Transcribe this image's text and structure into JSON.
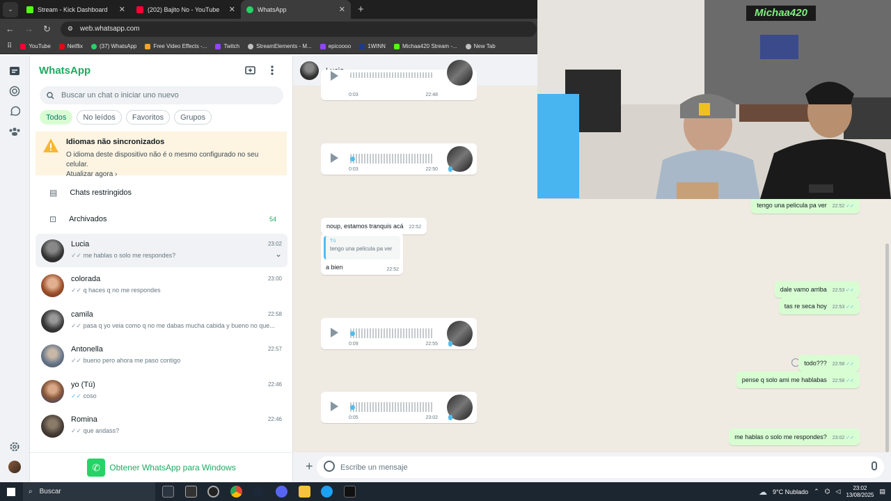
{
  "browser": {
    "tabs": [
      {
        "title": "Stream - Kick Dashboard",
        "color": "#53fc18"
      },
      {
        "title": "(202) Bajito No - YouTube",
        "color": "#ff0033"
      },
      {
        "title": "WhatsApp",
        "color": "#25d366"
      }
    ],
    "url": "web.whatsapp.com",
    "bookmarks": [
      {
        "label": "YouTube",
        "color": "#ff0033"
      },
      {
        "label": "Netflix",
        "color": "#e50914"
      },
      {
        "label": "(37) WhatsApp",
        "color": "#25d366"
      },
      {
        "label": "Free Video Effects -...",
        "color": "#f5a623"
      },
      {
        "label": "Twitch",
        "color": "#9146ff"
      },
      {
        "label": "StreamElements - M...",
        "color": "#c0c0c0"
      },
      {
        "label": "epicoooo",
        "color": "#9146ff"
      },
      {
        "label": "1WINN",
        "color": "#1e3a8a"
      },
      {
        "label": "Michaa420 Stream -...",
        "color": "#53fc18"
      },
      {
        "label": "New Tab",
        "color": "#c0c0c0"
      }
    ]
  },
  "sidebar": {
    "brand": "WhatsApp",
    "search_placeholder": "Buscar un chat o iniciar uno nuevo",
    "filters": [
      "Todos",
      "No leídos",
      "Favoritos",
      "Grupos"
    ],
    "warning": {
      "title": "Idiomas não sincronizados",
      "body": "O idioma deste dispositivo não é o mesmo configurado no seu celular.",
      "link": "Atualizar agora"
    },
    "restricted": "Chats restringidos",
    "archived": "Archivados",
    "archived_count": "54",
    "chats": [
      {
        "name": "Lucia",
        "time": "23:02",
        "msg": "me hablas o solo me respondes?",
        "tick": "grey",
        "avatar": "#555"
      },
      {
        "name": "colorada",
        "time": "23:00",
        "msg": "q haces q no me respondes",
        "tick": "grey",
        "avatar": "#a0522d"
      },
      {
        "name": "camila",
        "time": "22:58",
        "msg": "pasa q yo veia como q no me dabas mucha cabida y bueno no que...",
        "tick": "grey",
        "avatar": "#3a3a3a"
      },
      {
        "name": "Antonella",
        "time": "22:57",
        "msg": "bueno pero ahora me paso contigo",
        "tick": "grey",
        "avatar": "#6b7a8c"
      },
      {
        "name": "yo (Tú)",
        "time": "22:46",
        "msg": "coso",
        "tick": "blue",
        "avatar": "#8b5a3c"
      },
      {
        "name": "Romina",
        "time": "22:46",
        "msg": "que andass?",
        "tick": "grey",
        "avatar": "#4a4038"
      }
    ],
    "get_app": "Obtener WhatsApp para Windows"
  },
  "conversation": {
    "contact": "Lucia",
    "voice_notes": [
      {
        "duration": "0:03",
        "time": "22:48"
      },
      {
        "duration": "0:03",
        "time": "22:50"
      },
      {
        "duration": "0:09",
        "time": "22:55"
      },
      {
        "duration": "0:05",
        "time": "23:02"
      }
    ],
    "incoming": {
      "text1": "noup, estamos tranquis acá",
      "time1": "22:52",
      "quote_author": "Tú",
      "quote_text": "tengo una pelicula pa ver",
      "text2": "a bien",
      "time2": "22:52"
    },
    "outgoing": [
      {
        "text": "tengo una pelicula pa ver",
        "time": "22:52"
      },
      {
        "text": "dale vamo arriba",
        "time": "22:53"
      },
      {
        "text": "tas re seca hoy",
        "time": "22:53"
      },
      {
        "text": "todo???",
        "time": "22:58"
      },
      {
        "text": "pense q solo ami me hablabas",
        "time": "22:58"
      },
      {
        "text": "me hablas o solo me respondes?",
        "time": "23:02"
      }
    ],
    "composer_placeholder": "Escribe un mensaje"
  },
  "webcam": {
    "overlay_name": "Michaa420"
  },
  "taskbar": {
    "search": "Buscar",
    "weather": "9°C  Nublado",
    "time": "23:02",
    "date": "13/08/2025"
  }
}
